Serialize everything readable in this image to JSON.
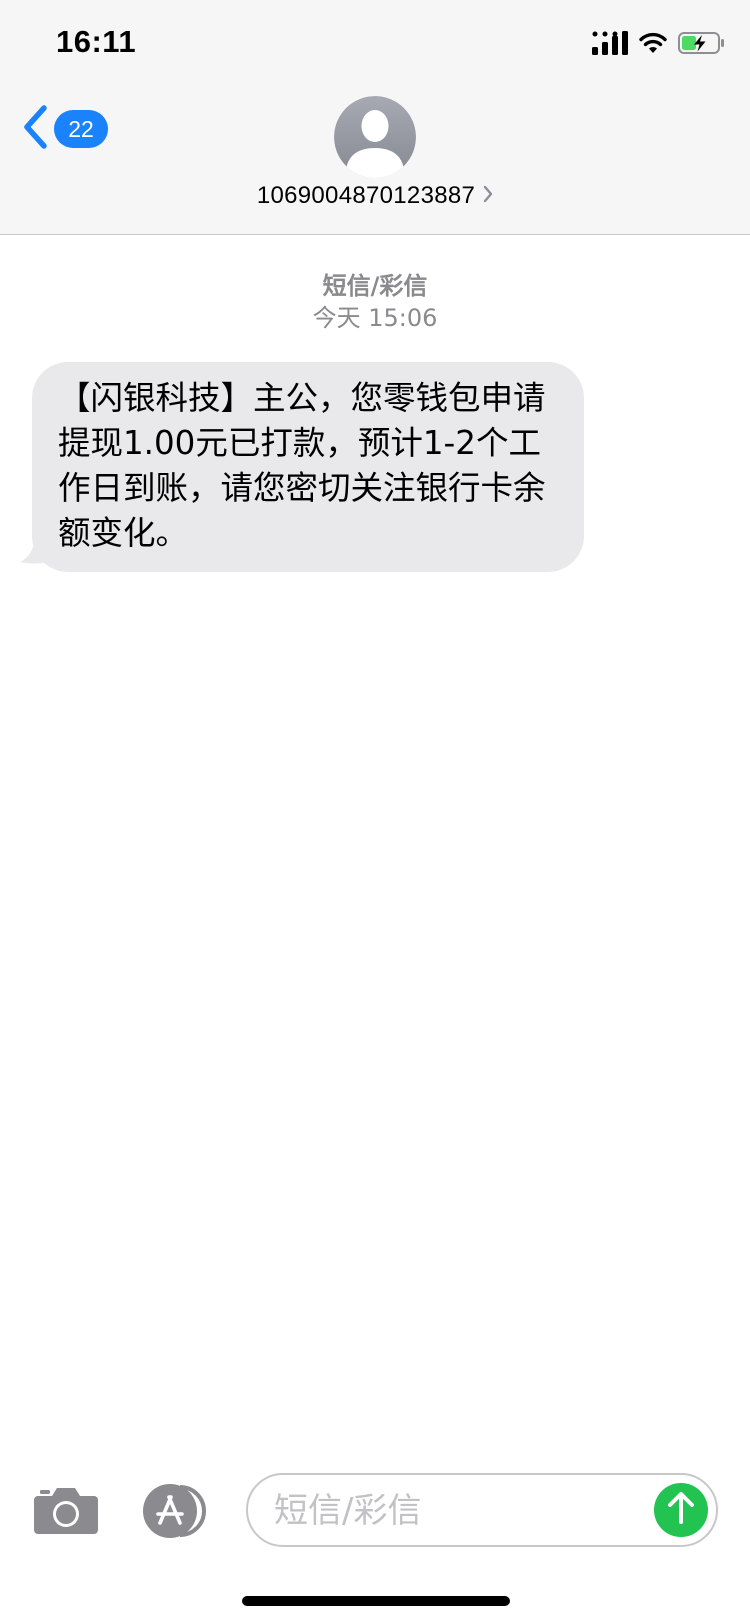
{
  "status_bar": {
    "time": "16:11",
    "icons": [
      "cellular-signal-icon",
      "wifi-icon",
      "battery-charging-icon"
    ],
    "battery_color": "#4cd964"
  },
  "nav": {
    "back_icon": "chevron-left-icon",
    "back_count": "22",
    "avatar_icon": "person-silhouette-icon",
    "contact_number": "1069004870123887",
    "contact_chevron_icon": "chevron-right-icon",
    "accent_color": "#1a82fb"
  },
  "thread": {
    "message_type": "短信/彩信",
    "timestamp": "今天 15:06"
  },
  "messages": [
    {
      "direction": "incoming",
      "text": "【闪银科技】主公，您零钱包申请提现1.00元已打款，预计1-2个工作日到账，请您密切关注银行卡余额变化。",
      "bubble_color": "#e9e9eb"
    }
  ],
  "compose": {
    "camera_icon": "camera-icon",
    "apps_icon": "app-store-icon",
    "placeholder": "短信/彩信",
    "value": "",
    "send_icon": "arrow-up-icon",
    "send_color": "#22c351"
  }
}
